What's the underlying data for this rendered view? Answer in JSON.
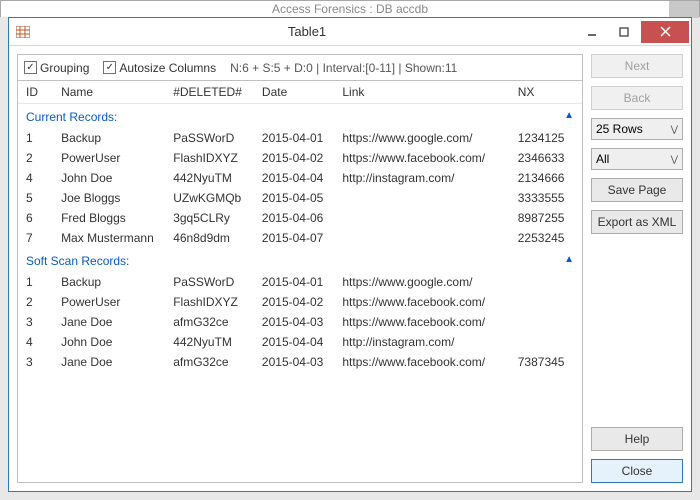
{
  "parentTitle": "Access Forensics : DB accdb",
  "window": {
    "title": "Table1"
  },
  "toolbar": {
    "grouping": "Grouping",
    "autosize": "Autosize Columns",
    "status": "N:6 + S:5 + D:0 | Interval:[0-11] | Shown:11"
  },
  "columns": [
    "ID",
    "Name",
    "#DELETED#",
    "Date",
    "Link",
    "NX"
  ],
  "groups": [
    {
      "label": "Current Records:",
      "rows": [
        {
          "id": "1",
          "name": "Backup",
          "del": "PaSSWorD",
          "date": "2015-04-01",
          "link": "https://www.google.com/",
          "nx": "1234125"
        },
        {
          "id": "2",
          "name": "PowerUser",
          "del": "FlashIDXYZ",
          "date": "2015-04-02",
          "link": "https://www.facebook.com/",
          "nx": "2346633"
        },
        {
          "id": "4",
          "name": "John Doe",
          "del": "442NyuTM",
          "date": "2015-04-04",
          "link": "http://instagram.com/",
          "nx": "2134666"
        },
        {
          "id": "5",
          "name": "Joe Bloggs",
          "del": "UZwKGMQb",
          "date": "2015-04-05",
          "link": "",
          "nx": "3333555"
        },
        {
          "id": "6",
          "name": "Fred Bloggs",
          "del": "3gq5CLRy",
          "date": "2015-04-06",
          "link": "",
          "nx": "8987255"
        },
        {
          "id": "7",
          "name": "Max Mustermann",
          "del": "46n8d9dm",
          "date": "2015-04-07",
          "link": "",
          "nx": "2253245"
        }
      ]
    },
    {
      "label": "Soft Scan Records:",
      "rows": [
        {
          "id": "1",
          "name": "Backup",
          "del": "PaSSWorD",
          "date": "2015-04-01",
          "link": "https://www.google.com/",
          "nx": ""
        },
        {
          "id": "2",
          "name": "PowerUser",
          "del": "FlashIDXYZ",
          "date": "2015-04-02",
          "link": "https://www.facebook.com/",
          "nx": ""
        },
        {
          "id": "3",
          "name": "Jane Doe",
          "del": "afmG32ce",
          "date": "2015-04-03",
          "link": "https://www.facebook.com/",
          "nx": ""
        },
        {
          "id": "4",
          "name": "John Doe",
          "del": "442NyuTM",
          "date": "2015-04-04",
          "link": "http://instagram.com/",
          "nx": ""
        },
        {
          "id": "3",
          "name": "Jane Doe",
          "del": "afmG32ce",
          "date": "2015-04-03",
          "link": "https://www.facebook.com/",
          "nx": "7387345"
        }
      ]
    }
  ],
  "buttons": {
    "next": "Next",
    "back": "Back",
    "savePage": "Save Page",
    "exportXml": "Export as XML",
    "help": "Help",
    "close": "Close"
  },
  "selects": {
    "rows": "25 Rows",
    "filter": "All"
  }
}
